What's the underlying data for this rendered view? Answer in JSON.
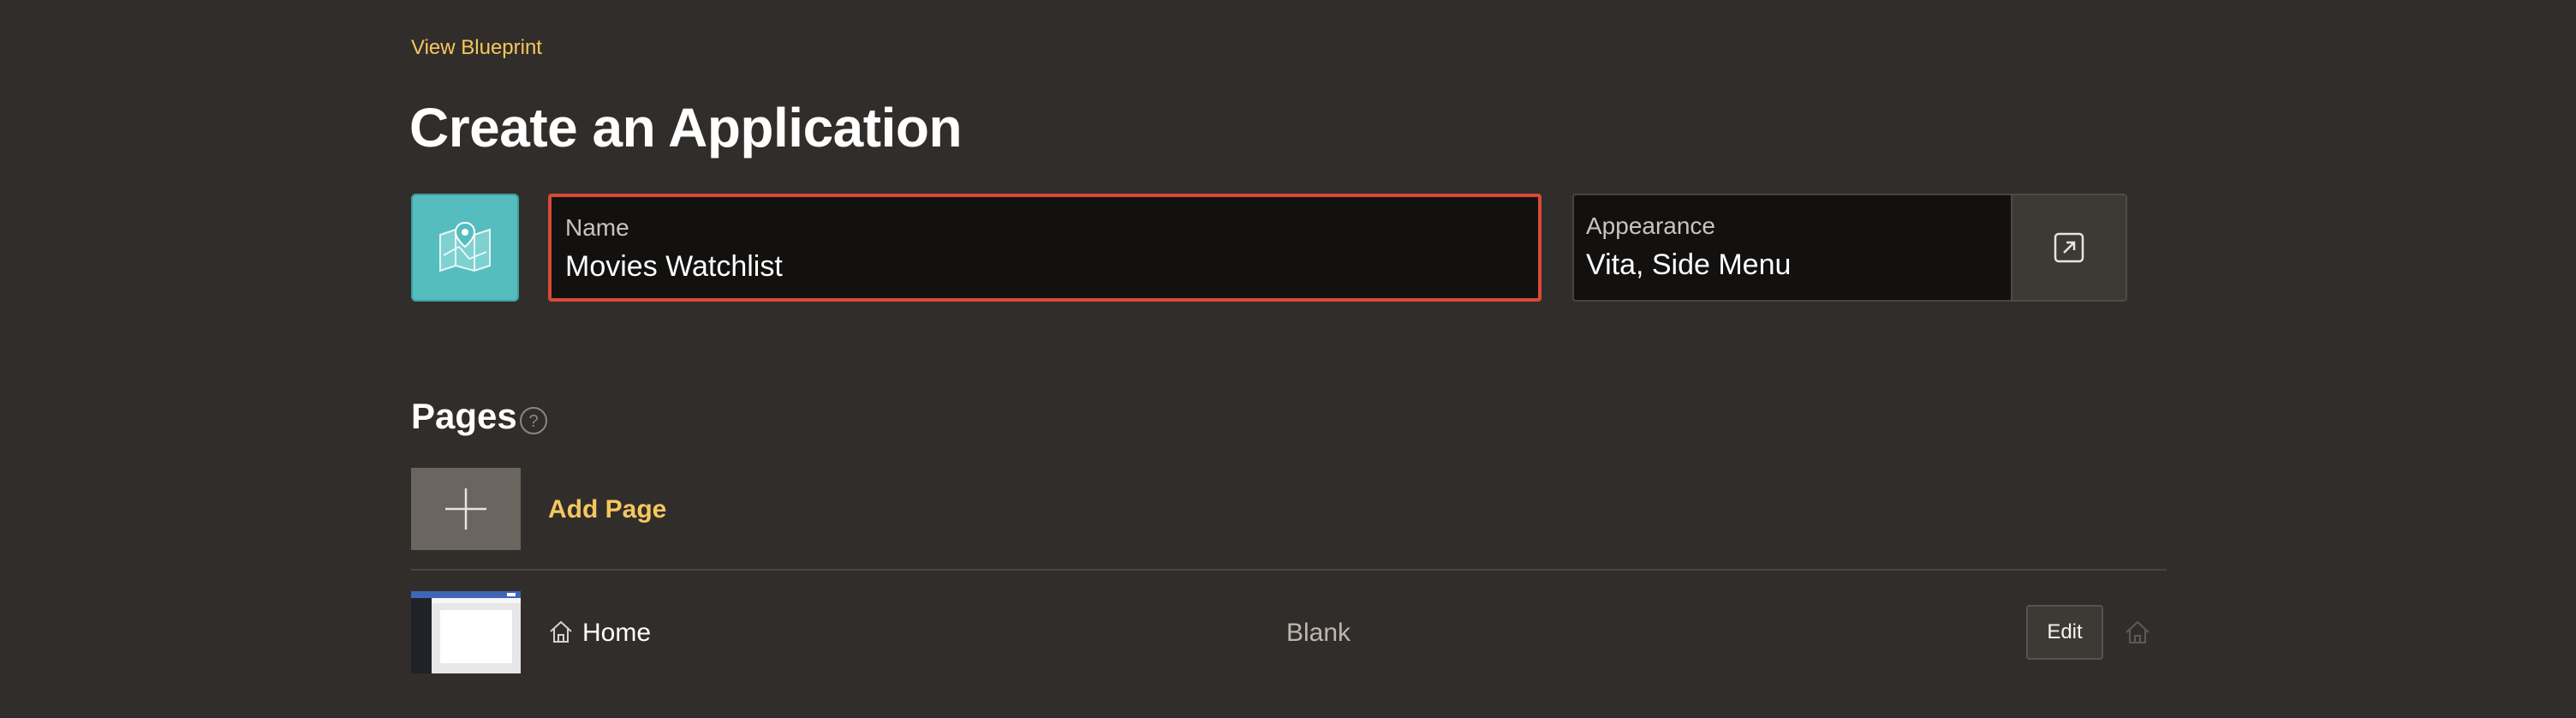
{
  "header": {
    "blueprint_link": "View Blueprint",
    "title": "Create an Application"
  },
  "app": {
    "icon": "map-pin-icon",
    "icon_color": "#56bdbf",
    "name_label": "Name",
    "name_value": "Movies Watchlist",
    "appearance_label": "Appearance",
    "appearance_value": "Vita, Side Menu",
    "appearance_button_icon": "external-link-icon"
  },
  "pages": {
    "title": "Pages",
    "help_icon": "help-icon",
    "add_page_label": "Add Page",
    "items": [
      {
        "icon": "home-icon",
        "name": "Home",
        "type": "Blank",
        "edit_label": "Edit",
        "home_page_icon": "home-icon"
      }
    ]
  },
  "colors": {
    "background": "#312d2a",
    "accent": "#f6c760",
    "error_border": "#d94a36"
  }
}
